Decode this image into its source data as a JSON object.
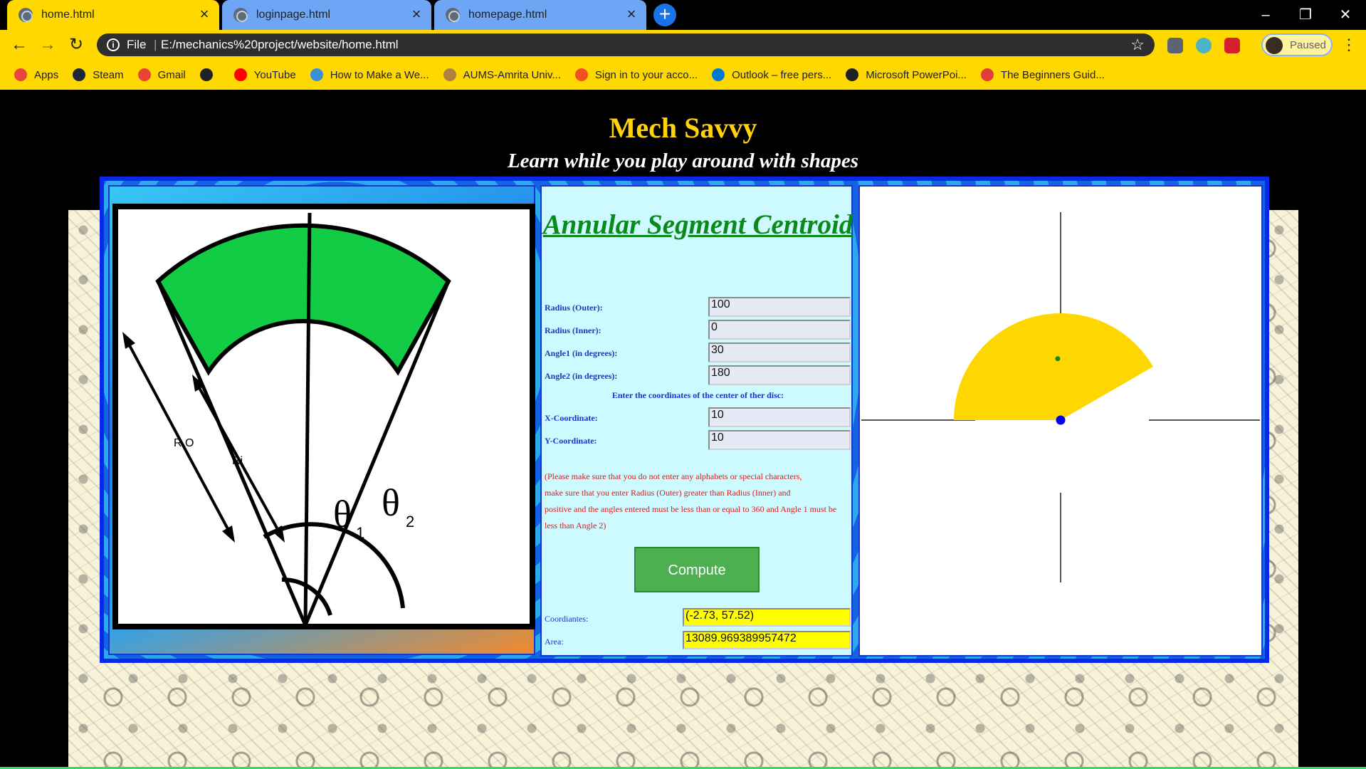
{
  "browser": {
    "tabs": [
      {
        "title": "home.html",
        "active": true
      },
      {
        "title": "loginpage.html",
        "active": false
      },
      {
        "title": "homepage.html",
        "active": false
      }
    ],
    "address": {
      "scheme": "File",
      "url": "E:/mechanics%20project/website/home.html"
    },
    "profile_status": "Paused",
    "bookmarks": [
      {
        "label": "Apps",
        "icon": "apps-grid-icon",
        "color": "#e8453c"
      },
      {
        "label": "Steam",
        "icon": "steam-icon",
        "color": "#1b2838"
      },
      {
        "label": "Gmail",
        "icon": "gmail-icon",
        "color": "#ea4335"
      },
      {
        "label": "",
        "icon": "globe-icon",
        "color": "#202124"
      },
      {
        "label": "YouTube",
        "icon": "youtube-icon",
        "color": "#ff0000"
      },
      {
        "label": "How to Make a We...",
        "icon": "bookmark-site-icon",
        "color": "#3b8fd8"
      },
      {
        "label": "AUMS-Amrita Univ...",
        "icon": "amrita-icon",
        "color": "#b08040"
      },
      {
        "label": "Sign in to your acco...",
        "icon": "microsoft-icon",
        "color": "#f25022"
      },
      {
        "label": "Outlook – free pers...",
        "icon": "outlook-icon",
        "color": "#0078d4"
      },
      {
        "label": "Microsoft PowerPoi...",
        "icon": "globe-icon",
        "color": "#202124"
      },
      {
        "label": "The Beginners Guid...",
        "icon": "beginners-guide-icon",
        "color": "#e23c3c"
      }
    ]
  },
  "page": {
    "title": "Mech Savvy",
    "subtitle": "Learn while you play around with shapes"
  },
  "diagram": {
    "labels": {
      "outer_radius": "R O",
      "inner_radius": "Ri",
      "theta1": "θ",
      "theta1_sub": "1",
      "theta2": "θ",
      "theta2_sub": "2"
    },
    "fill_color": "#12cc46"
  },
  "form": {
    "heading": "Annular Segment Centroid",
    "fields": [
      {
        "label": "Radius (Outer):",
        "value": "100"
      },
      {
        "label": "Radius (Inner):",
        "value": "0"
      },
      {
        "label": "Angle1 (in degrees):",
        "value": "30"
      },
      {
        "label": "Angle2 (in degrees):",
        "value": "180"
      }
    ],
    "center_prompt": "Enter the coordinates of the center of ther disc:",
    "coords": [
      {
        "label": "X-Coordinate:",
        "value": "10"
      },
      {
        "label": "Y-Coordinate:",
        "value": "10"
      }
    ],
    "notice_lines": [
      "(Please make sure that you do not enter any alphabets or special characters,",
      "make sure that you enter Radius (Outer) greater than Radius (Inner) and",
      "positive and the angles entered must be less than or equal to 360 and Angle 1 must be",
      "less than Angle 2)"
    ],
    "compute_label": "Compute",
    "outputs": [
      {
        "label": "Coordiantes:",
        "value": "(-2.73, 57.52)"
      },
      {
        "label": "Area:",
        "value": "13089.969389957472"
      }
    ]
  },
  "plot": {
    "segment": {
      "outer_radius": 100,
      "inner_radius": 0,
      "angle1_deg": 30,
      "angle2_deg": 180,
      "color": "#ffd700"
    },
    "centroid": {
      "x": -2.73,
      "y": 57.52,
      "color": "#1a8a1a"
    },
    "center_point_color": "#0000ee",
    "axis_color": "#555555"
  }
}
